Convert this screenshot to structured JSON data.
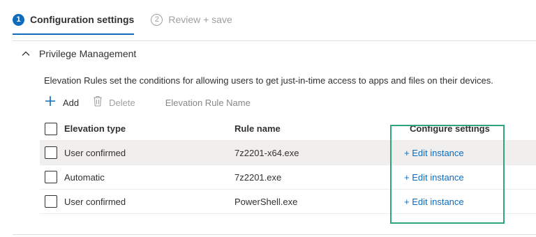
{
  "wizard": {
    "tabs": [
      {
        "number": "1",
        "label": "Configuration settings",
        "active": true
      },
      {
        "number": "2",
        "label": "Review + save",
        "active": false
      }
    ]
  },
  "section": {
    "title": "Privilege Management",
    "expanded": true,
    "description": "Elevation Rules set the conditions for allowing users to get just-in-time access to apps and files on their devices."
  },
  "toolbar": {
    "add_label": "Add",
    "delete_label": "Delete",
    "filter_placeholder": "Elevation Rule Name"
  },
  "table": {
    "columns": {
      "elevation_type": "Elevation type",
      "rule_name": "Rule name",
      "configure_settings": "Configure settings"
    },
    "rows": [
      {
        "elevation_type": "User confirmed",
        "rule_name": "7z2201-x64.exe",
        "action": "+ Edit instance"
      },
      {
        "elevation_type": "Automatic",
        "rule_name": "7z2201.exe",
        "action": "+ Edit instance"
      },
      {
        "elevation_type": "User confirmed",
        "rule_name": "PowerShell.exe",
        "action": "+ Edit instance"
      }
    ]
  },
  "colors": {
    "accent": "#0f6cbd",
    "highlight_box": "#2ea47c",
    "disabled_text": "#a19f9d"
  },
  "icons": {
    "chevron": "chevron-up-icon",
    "add": "plus-icon",
    "delete": "trash-icon"
  }
}
